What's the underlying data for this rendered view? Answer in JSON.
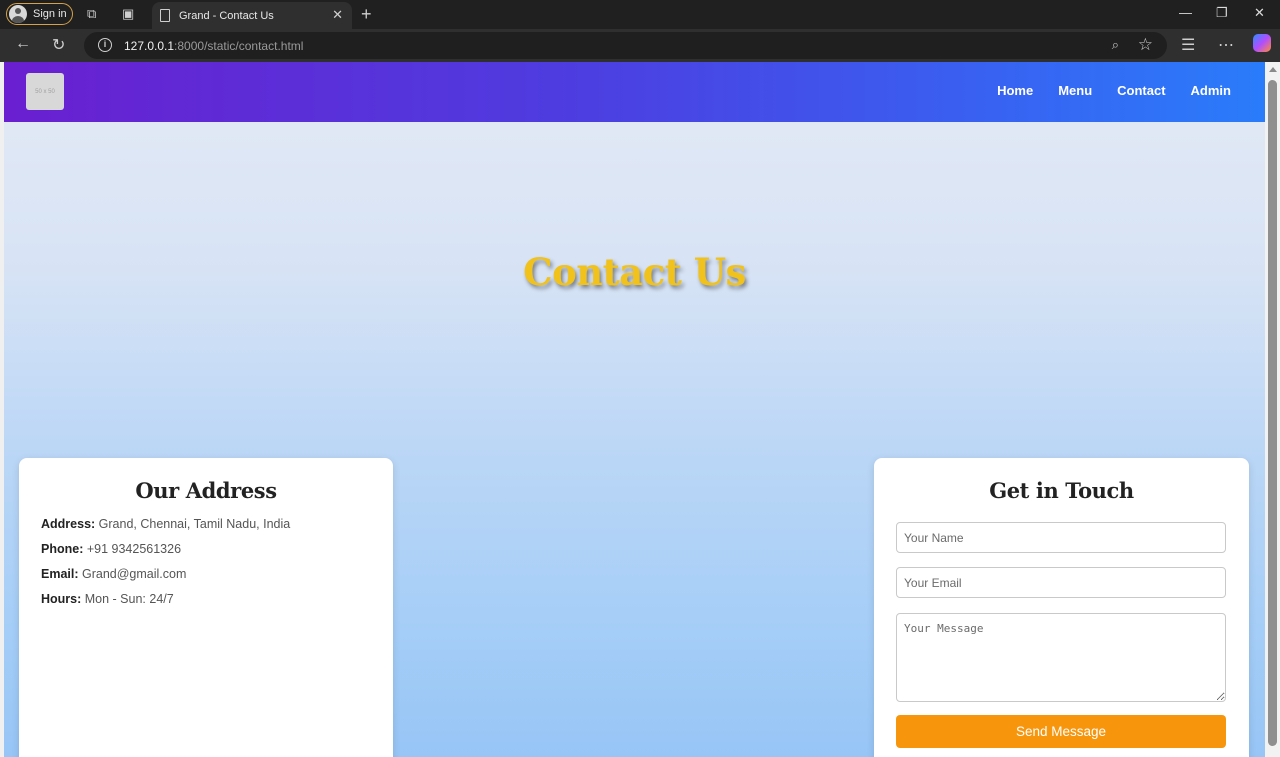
{
  "browser": {
    "signin_label": "Sign in",
    "tab_title": "Grand - Contact Us",
    "url_host": "127.0.0.1",
    "url_path": ":8000/static/contact.html"
  },
  "site": {
    "logo_text": "50 x 50",
    "nav": [
      "Home",
      "Menu",
      "Contact",
      "Admin"
    ]
  },
  "hero": {
    "title": "Contact Us"
  },
  "address_card": {
    "heading": "Our Address",
    "rows": [
      {
        "label": "Address:",
        "value": " Grand, Chennai, Tamil Nadu, India"
      },
      {
        "label": "Phone:",
        "value": " +91 9342561326"
      },
      {
        "label": "Email:",
        "value": " Grand@gmail.com"
      },
      {
        "label": "Hours:",
        "value": " Mon - Sun: 24/7"
      }
    ]
  },
  "contact_form": {
    "heading": "Get in Touch",
    "name_placeholder": "Your Name",
    "email_placeholder": "Your Email",
    "message_placeholder": "Your Message",
    "submit_label": "Send Message"
  },
  "colors": {
    "header_gradient_start": "#6a1fd0",
    "header_gradient_end": "#2a7cfb",
    "hero_title": "#f1c21b",
    "submit_button": "#f7960d"
  }
}
